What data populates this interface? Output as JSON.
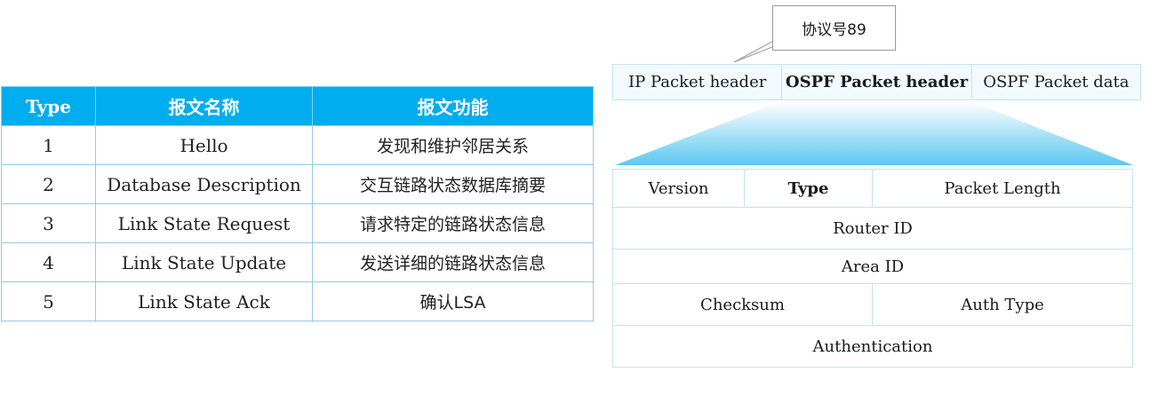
{
  "table": {
    "headers": [
      "Type",
      "报文名称",
      "报文功能"
    ],
    "rows": [
      [
        "1",
        "Hello",
        "发现和维护邻居关系"
      ],
      [
        "2",
        "Database Description",
        "交互链路状态数据库摘要"
      ],
      [
        "3",
        "Link State Request",
        "请求特定的链路状态信息"
      ],
      [
        "4",
        "Link State Update",
        "发送详细的链路状态信息"
      ],
      [
        "5",
        "Link State Ack",
        "确认LSA"
      ]
    ]
  },
  "callout": {
    "text": "协议号89"
  },
  "packet": {
    "segments": [
      "IP Packet header",
      "OSPF Packet header",
      "OSPF Packet data"
    ]
  },
  "ospf_header": {
    "version": "Version",
    "type": "Type",
    "packet_length": "Packet Length",
    "router_id": "Router ID",
    "area_id": "Area ID",
    "checksum": "Checksum",
    "auth_type": "Auth Type",
    "authentication": "Authentication"
  },
  "colors": {
    "table_header_bg": "#00adef",
    "border": "#9ac8e2",
    "expand_gradient_top": "#ffffff",
    "expand_gradient_bottom": "#5cc8f0"
  }
}
